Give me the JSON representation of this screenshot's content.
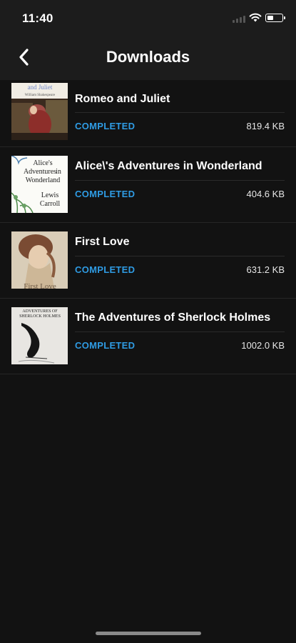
{
  "status_bar": {
    "time": "11:40"
  },
  "header": {
    "title": "Downloads"
  },
  "downloads": [
    {
      "title": "Romeo and Juliet",
      "status": "COMPLETED",
      "size": "819.4 KB",
      "cover_text": [
        "and Juliet",
        "William Shakespeare"
      ]
    },
    {
      "title": "Alice\\'s Adventures in Wonderland",
      "status": "COMPLETED",
      "size": "404.6 KB",
      "cover_text": [
        "Alice's",
        "Adventures",
        "in",
        "Wonderland",
        "Lewis",
        "Carroll"
      ]
    },
    {
      "title": "First Love",
      "status": "COMPLETED",
      "size": "631.2 KB",
      "cover_text": [
        "First Love"
      ]
    },
    {
      "title": "The Adventures of Sherlock Holmes",
      "status": "COMPLETED",
      "size": "1002.0 KB",
      "cover_text": [
        "ADVENTURES OF",
        "SHERLOCK HOLMES"
      ]
    }
  ],
  "colors": {
    "accent": "#2f9be3",
    "background": "#121212",
    "bar": "#1c1c1c"
  }
}
